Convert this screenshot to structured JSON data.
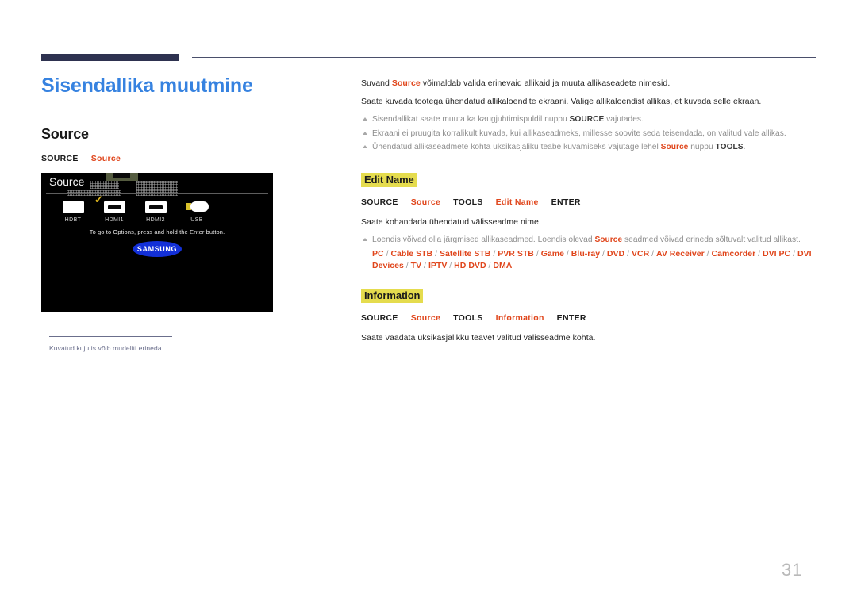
{
  "page": {
    "title": "Sisendallika muutmine",
    "number": "31"
  },
  "left": {
    "section_heading": "Source",
    "path": {
      "source_key": "SOURCE",
      "source_menu": "Source"
    },
    "tv": {
      "osd_title": "Source",
      "sources": [
        {
          "label": "HDBT",
          "icon": "hdbt-connector-icon",
          "selected": false
        },
        {
          "label": "HDMI1",
          "icon": "hdmi-connector-icon",
          "selected": true
        },
        {
          "label": "HDMI2",
          "icon": "hdmi-connector-icon",
          "selected": false
        },
        {
          "label": "USB",
          "icon": "usb-connector-icon",
          "selected": false
        }
      ],
      "check_mark": "✓",
      "hint": "To go to Options, press and hold the Enter button.",
      "logo": "SAMSUNG"
    },
    "caption": "Kuvatud kujutis võib mudeliti erineda."
  },
  "right": {
    "intro": {
      "p1_before": "Suvand ",
      "p1_red": "Source",
      "p1_after": " võimaldab valida erinevaid allikaid ja muuta allikaseadete nimesid.",
      "p2": "Saate kuvada tootega ühendatud allikaloendite ekraani. Valige allikaloendist allikas, et kuvada selle ekraan.",
      "bullets": [
        {
          "parts": [
            {
              "t": "Sisendallikat saate muuta ka kaugjuhtimispuldil nuppu ",
              "s": "normal"
            },
            {
              "t": "SOURCE",
              "s": "bold"
            },
            {
              "t": " vajutades.",
              "s": "normal"
            }
          ]
        },
        {
          "parts": [
            {
              "t": "Ekraani ei pruugita korralikult kuvada, kui allikaseadmeks, millesse soovite seda teisendada, on valitud vale allikas.",
              "s": "normal"
            }
          ]
        },
        {
          "parts": [
            {
              "t": "Ühendatud allikaseadmete kohta üksikasjaliku teabe kuvamiseks vajutage lehel ",
              "s": "normal"
            },
            {
              "t": "Source",
              "s": "red"
            },
            {
              "t": " nuppu ",
              "s": "normal"
            },
            {
              "t": "TOOLS",
              "s": "bold"
            },
            {
              "t": ".",
              "s": "normal"
            }
          ]
        }
      ]
    },
    "edit_name": {
      "heading": "Edit Name",
      "path": [
        "SOURCE",
        "Source",
        "TOOLS",
        "Edit Name",
        "ENTER"
      ],
      "path_colors": [
        "black",
        "red",
        "black",
        "red",
        "black"
      ],
      "body": "Saate kohandada ühendatud välisseadme nime.",
      "bullet": {
        "parts": [
          {
            "t": "Loendis võivad olla järgmised allikaseadmed. Loendis olevad ",
            "s": "normal"
          },
          {
            "t": "Source",
            "s": "red"
          },
          {
            "t": " seadmed võivad erineda sõltuvalt valitud allikast.",
            "s": "normal"
          }
        ]
      },
      "devices": [
        "PC",
        "Cable STB",
        "Satellite STB",
        "PVR STB",
        "Game",
        "Blu-ray",
        "DVD",
        "VCR",
        "AV Receiver",
        "Camcorder",
        "DVI PC",
        "DVI Devices",
        "TV",
        "IPTV",
        "HD DVD",
        "DMA"
      ]
    },
    "information": {
      "heading": "Information",
      "path": [
        "SOURCE",
        "Source",
        "TOOLS",
        "Information",
        "ENTER"
      ],
      "path_colors": [
        "black",
        "red",
        "black",
        "red",
        "black"
      ],
      "body": "Saate vaadata üksikasjalikku teavet valitud välisseadme kohta."
    }
  },
  "colors": {
    "title_blue": "#3682e0",
    "accent_red": "#e0461c",
    "highlight_yellow": "#e5dc4e",
    "rule_navy": "#2e3250"
  }
}
